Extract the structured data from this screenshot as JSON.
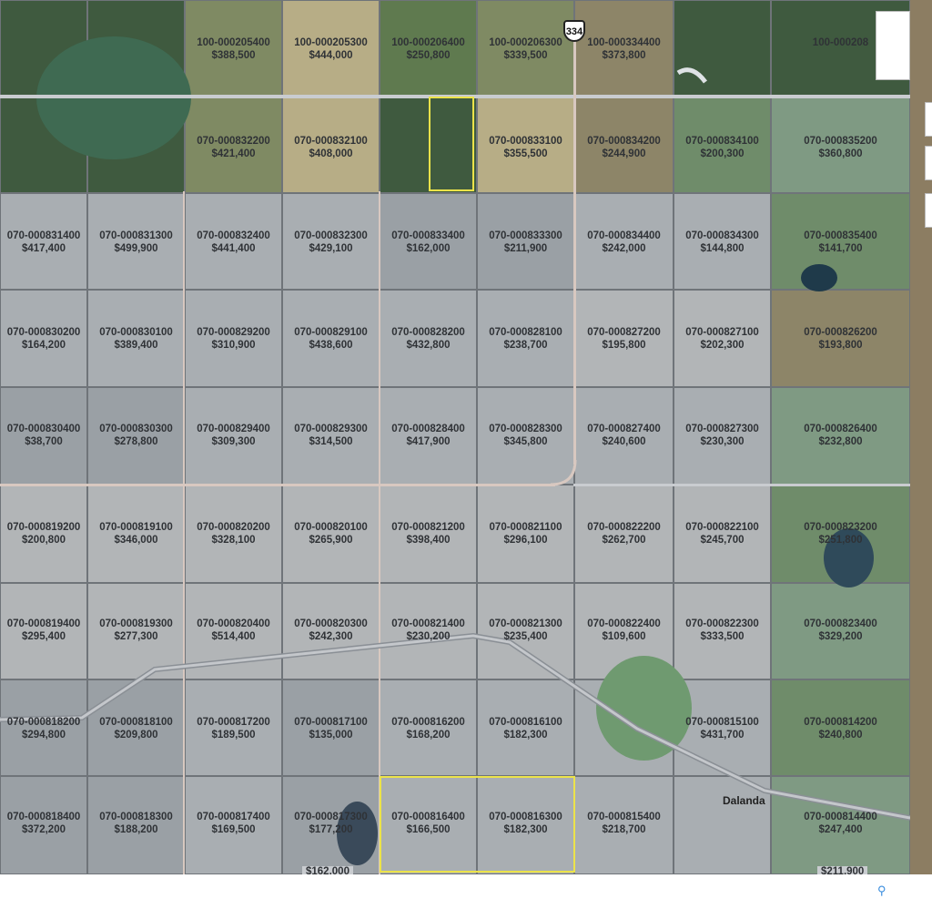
{
  "highway": "334",
  "town": "Dalanda",
  "bottom_labels": [
    "$162,000",
    "$211,900"
  ],
  "rows": [
    [
      {
        "id": "",
        "price": "",
        "shade": "crop-dark"
      },
      {
        "id": "",
        "price": "",
        "shade": "crop-dark"
      },
      {
        "id": "100-000205400",
        "price": "$388,500",
        "shade": "crop-olive"
      },
      {
        "id": "100-000205300",
        "price": "$444,000",
        "shade": "crop-tan"
      },
      {
        "id": "100-000206400",
        "price": "$250,800",
        "shade": "crop-green"
      },
      {
        "id": "100-000206300",
        "price": "$339,500",
        "shade": "crop-olive"
      },
      {
        "id": "100-000334400",
        "price": "$373,800",
        "shade": "crop-brown"
      },
      {
        "id": "",
        "price": "",
        "shade": "crop-dark"
      },
      {
        "id": "100-000208",
        "price": "",
        "shade": "crop-dark"
      }
    ],
    [
      {
        "id": "",
        "price": "",
        "shade": "crop-dark"
      },
      {
        "id": "",
        "price": "",
        "shade": "crop-dark"
      },
      {
        "id": "070-000832200",
        "price": "$421,400",
        "shade": "crop-olive"
      },
      {
        "id": "070-000832100",
        "price": "$408,000",
        "shade": "crop-tan"
      },
      {
        "id": "",
        "price": "",
        "shade": "crop-dark"
      },
      {
        "id": "070-000833100",
        "price": "$355,500",
        "shade": "crop-tan"
      },
      {
        "id": "070-000834200",
        "price": "$244,900",
        "shade": "crop-brown"
      },
      {
        "id": "070-000834100",
        "price": "$200,300",
        "shade": "nat"
      },
      {
        "id": "070-000835200",
        "price": "$360,800",
        "shade": "nat2"
      }
    ],
    [
      {
        "id": "070-000831400",
        "price": "$417,400",
        "shade": "shade-a"
      },
      {
        "id": "070-000831300",
        "price": "$499,900",
        "shade": "shade-a"
      },
      {
        "id": "070-000832400",
        "price": "$441,400",
        "shade": "shade-a"
      },
      {
        "id": "070-000832300",
        "price": "$429,100",
        "shade": "shade-a"
      },
      {
        "id": "070-000833400",
        "price": "$162,000",
        "shade": "shade-b"
      },
      {
        "id": "070-000833300",
        "price": "$211,900",
        "shade": "shade-b"
      },
      {
        "id": "070-000834400",
        "price": "$242,000",
        "shade": "shade-a"
      },
      {
        "id": "070-000834300",
        "price": "$144,800",
        "shade": "shade-a"
      },
      {
        "id": "070-000835400",
        "price": "$141,700",
        "shade": "nat"
      }
    ],
    [
      {
        "id": "070-000830200",
        "price": "$164,200",
        "shade": "shade-a"
      },
      {
        "id": "070-000830100",
        "price": "$389,400",
        "shade": "shade-a"
      },
      {
        "id": "070-000829200",
        "price": "$310,900",
        "shade": "shade-a"
      },
      {
        "id": "070-000829100",
        "price": "$438,600",
        "shade": "shade-a"
      },
      {
        "id": "070-000828200",
        "price": "$432,800",
        "shade": "shade-a"
      },
      {
        "id": "070-000828100",
        "price": "$238,700",
        "shade": "shade-a"
      },
      {
        "id": "070-000827200",
        "price": "$195,800",
        "shade": "shade-c"
      },
      {
        "id": "070-000827100",
        "price": "$202,300",
        "shade": "shade-c"
      },
      {
        "id": "070-000826200",
        "price": "$193,800",
        "shade": "crop-brown"
      }
    ],
    [
      {
        "id": "070-000830400",
        "price": "$38,700",
        "shade": "shade-b"
      },
      {
        "id": "070-000830300",
        "price": "$278,800",
        "shade": "shade-b"
      },
      {
        "id": "070-000829400",
        "price": "$309,300",
        "shade": "shade-a"
      },
      {
        "id": "070-000829300",
        "price": "$314,500",
        "shade": "shade-a"
      },
      {
        "id": "070-000828400",
        "price": "$417,900",
        "shade": "shade-a"
      },
      {
        "id": "070-000828300",
        "price": "$345,800",
        "shade": "shade-a"
      },
      {
        "id": "070-000827400",
        "price": "$240,600",
        "shade": "shade-a"
      },
      {
        "id": "070-000827300",
        "price": "$230,300",
        "shade": "shade-a"
      },
      {
        "id": "070-000826400",
        "price": "$232,800",
        "shade": "nat2"
      }
    ],
    [
      {
        "id": "070-000819200",
        "price": "$200,800",
        "shade": "shade-c"
      },
      {
        "id": "070-000819100",
        "price": "$346,000",
        "shade": "shade-c"
      },
      {
        "id": "070-000820200",
        "price": "$328,100",
        "shade": "shade-c"
      },
      {
        "id": "070-000820100",
        "price": "$265,900",
        "shade": "shade-c"
      },
      {
        "id": "070-000821200",
        "price": "$398,400",
        "shade": "shade-c"
      },
      {
        "id": "070-000821100",
        "price": "$296,100",
        "shade": "shade-c"
      },
      {
        "id": "070-000822200",
        "price": "$262,700",
        "shade": "shade-c"
      },
      {
        "id": "070-000822100",
        "price": "$245,700",
        "shade": "shade-c"
      },
      {
        "id": "070-000823200",
        "price": "$251,800",
        "shade": "nat"
      }
    ],
    [
      {
        "id": "070-000819400",
        "price": "$295,400",
        "shade": "shade-c"
      },
      {
        "id": "070-000819300",
        "price": "$277,300",
        "shade": "shade-c"
      },
      {
        "id": "070-000820400",
        "price": "$514,400",
        "shade": "shade-c"
      },
      {
        "id": "070-000820300",
        "price": "$242,300",
        "shade": "shade-c"
      },
      {
        "id": "070-000821400",
        "price": "$230,200",
        "shade": "shade-c"
      },
      {
        "id": "070-000821300",
        "price": "$235,400",
        "shade": "shade-c"
      },
      {
        "id": "070-000822400",
        "price": "$109,600",
        "shade": "shade-c"
      },
      {
        "id": "070-000822300",
        "price": "$333,500",
        "shade": "shade-c"
      },
      {
        "id": "070-000823400",
        "price": "$329,200",
        "shade": "nat2"
      }
    ],
    [
      {
        "id": "070-000818200",
        "price": "$294,800",
        "shade": "shade-b"
      },
      {
        "id": "070-000818100",
        "price": "$209,800",
        "shade": "shade-b"
      },
      {
        "id": "070-000817200",
        "price": "$189,500",
        "shade": "shade-a"
      },
      {
        "id": "070-000817100",
        "price": "$135,000",
        "shade": "shade-b"
      },
      {
        "id": "070-000816200",
        "price": "$168,200",
        "shade": "shade-a"
      },
      {
        "id": "070-000816100",
        "price": "$182,300",
        "shade": "shade-a"
      },
      {
        "id": "",
        "price": "",
        "shade": "shade-a"
      },
      {
        "id": "070-000815100",
        "price": "$431,700",
        "shade": "shade-a"
      },
      {
        "id": "070-000814200",
        "price": "$240,800",
        "shade": "nat"
      }
    ],
    [
      {
        "id": "070-000818400",
        "price": "$372,200",
        "shade": "shade-b"
      },
      {
        "id": "070-000818300",
        "price": "$188,200",
        "shade": "shade-b"
      },
      {
        "id": "070-000817400",
        "price": "$169,500",
        "shade": "shade-a"
      },
      {
        "id": "070-000817300",
        "price": "$177,200",
        "shade": "shade-b"
      },
      {
        "id": "070-000816400",
        "price": "$166,500",
        "shade": "shade-a"
      },
      {
        "id": "070-000816300",
        "price": "$182,300",
        "shade": "shade-a"
      },
      {
        "id": "070-000815400",
        "price": "$218,700",
        "shade": "shade-a"
      },
      {
        "id": "",
        "price": "",
        "shade": "shade-a"
      },
      {
        "id": "070-000814400",
        "price": "$247,400",
        "shade": "nat2"
      }
    ]
  ],
  "row_label_tops": [
    40,
    148,
    252,
    358,
    464,
    572,
    678,
    786,
    890
  ],
  "highlighted_parcels": [
    "070-000816400",
    "070-000816300"
  ],
  "highlight_color": "#ece34a",
  "road_color": "#d8c8c0"
}
